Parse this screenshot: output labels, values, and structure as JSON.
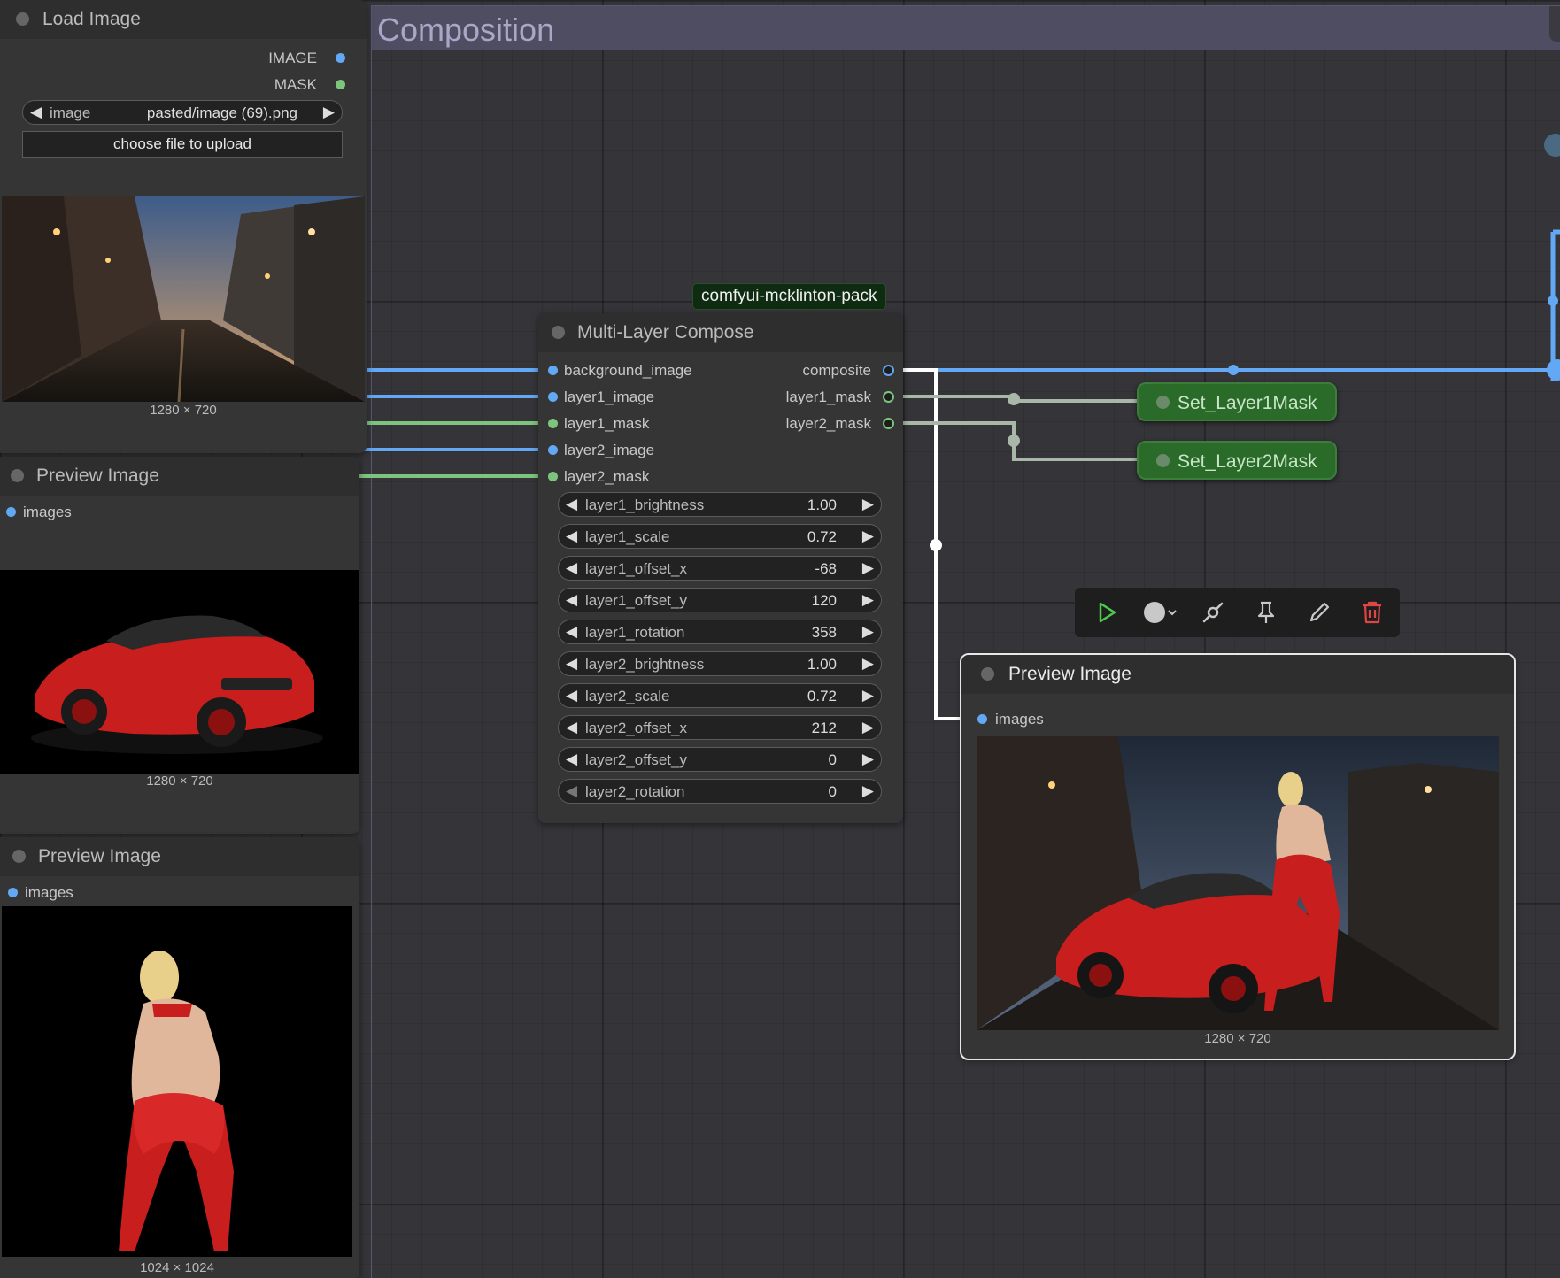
{
  "group": {
    "title": "Composition"
  },
  "load_image": {
    "title": "Load Image",
    "outputs": [
      "IMAGE",
      "MASK"
    ],
    "image_widget": {
      "name": "image",
      "value": "pasted/image (69).png"
    },
    "upload_label": "choose file to upload",
    "dims": "1280 × 720"
  },
  "preview1": {
    "title": "Preview Image",
    "input": "images",
    "dims": "1280 × 720"
  },
  "preview2": {
    "title": "Preview Image",
    "input": "images",
    "dims": "1024 × 1024"
  },
  "compose": {
    "pack_tag": "comfyui-mcklinton-pack",
    "title": "Multi-Layer Compose",
    "inputs": [
      "background_image",
      "layer1_image",
      "layer1_mask",
      "layer2_image",
      "layer2_mask"
    ],
    "outputs": [
      "composite",
      "layer1_mask",
      "layer2_mask"
    ],
    "widgets": [
      {
        "name": "layer1_brightness",
        "value": "1.00"
      },
      {
        "name": "layer1_scale",
        "value": "0.72"
      },
      {
        "name": "layer1_offset_x",
        "value": "-68"
      },
      {
        "name": "layer1_offset_y",
        "value": "120"
      },
      {
        "name": "layer1_rotation",
        "value": "358"
      },
      {
        "name": "layer2_brightness",
        "value": "1.00"
      },
      {
        "name": "layer2_scale",
        "value": "0.72"
      },
      {
        "name": "layer2_offset_x",
        "value": "212"
      },
      {
        "name": "layer2_offset_y",
        "value": "0"
      },
      {
        "name": "layer2_rotation",
        "value": "0"
      }
    ]
  },
  "set_nodes": [
    {
      "title": "Set_Layer1Mask"
    },
    {
      "title": "Set_Layer2Mask"
    }
  ],
  "preview_main": {
    "title": "Preview Image",
    "input": "images",
    "dims": "1280 × 720"
  },
  "toolbar": {
    "icons": [
      "play-icon",
      "color-circle-icon",
      "bypass-icon",
      "pin-icon",
      "edit-icon",
      "trash-icon"
    ]
  },
  "colors": {
    "image_port": "#62a8f5",
    "mask_port": "#7dc47d",
    "set_node": "#2a6b2a",
    "group_header": "#4f4d62",
    "delete": "#e04545",
    "run": "#4cc94c"
  }
}
